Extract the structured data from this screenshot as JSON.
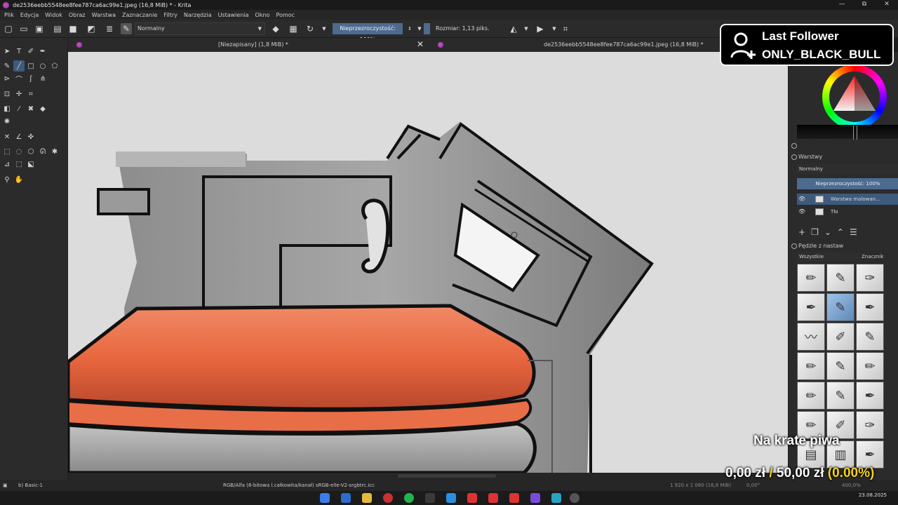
{
  "window": {
    "title": "de2536eebb5548ee8fee787ca6ac99e1.jpeg (16,8 MiB) * - Krita",
    "controls": [
      "—",
      "⧉",
      "✕"
    ]
  },
  "menu": [
    "Plik",
    "Edycja",
    "Widok",
    "Obraz",
    "Warstwa",
    "Zaznaczanie",
    "Filtry",
    "Narzędzia",
    "Ustawienia",
    "Okno",
    "Pomoc"
  ],
  "toolbar": {
    "blend_mode": "Normalny",
    "opacity": "Nieprzezroczystość: 100%",
    "size": "Rozmiar: 1,13 piks."
  },
  "tabs": [
    {
      "label": "[Niezapisany]  (1,8 MiB) *"
    },
    {
      "label": "de2536eebb5548ee8fee787ca6ac99e1.jpeg (16,8 MiB) *"
    }
  ],
  "layers": {
    "panel_title": "Warstwy",
    "blend": "Normalny",
    "opacity": "Nieprzezroczystość:  100%",
    "items": [
      {
        "name": "Warstwa malowan...",
        "selected": true
      },
      {
        "name": "Tło",
        "selected": false
      }
    ]
  },
  "brushes": {
    "panel_title": "Pędzle z nastaw",
    "filter": "Wszystkie",
    "tag_label": "Znacznik"
  },
  "status": {
    "brush": "b) Basic-1",
    "color_profile": "RGB/Alfa (8-bitowa l.całkowita/kanał)  sRGB-elle-V2-srgbtrc.icc",
    "dimensions": "1 920 x 1 080 (16,8 MiB)",
    "angle": "0,00°",
    "zoom": "400,0%"
  },
  "tray": {
    "date": "23.08.2025"
  },
  "overlay": {
    "follower_title": "Last Follower",
    "follower_name": "ONLY_BLACK_BULL",
    "goal_title": "Na krate piwa",
    "goal_current": "0,00 zł",
    "goal_separator": "/",
    "goal_target": "50,00 zł",
    "goal_percent": "(0.00%)"
  },
  "colors": {
    "accent": "#4d6a8f",
    "canvas_bg": "#dcdcdc",
    "orange": "#e8673f",
    "goal_yellow": "#f3d21b"
  }
}
